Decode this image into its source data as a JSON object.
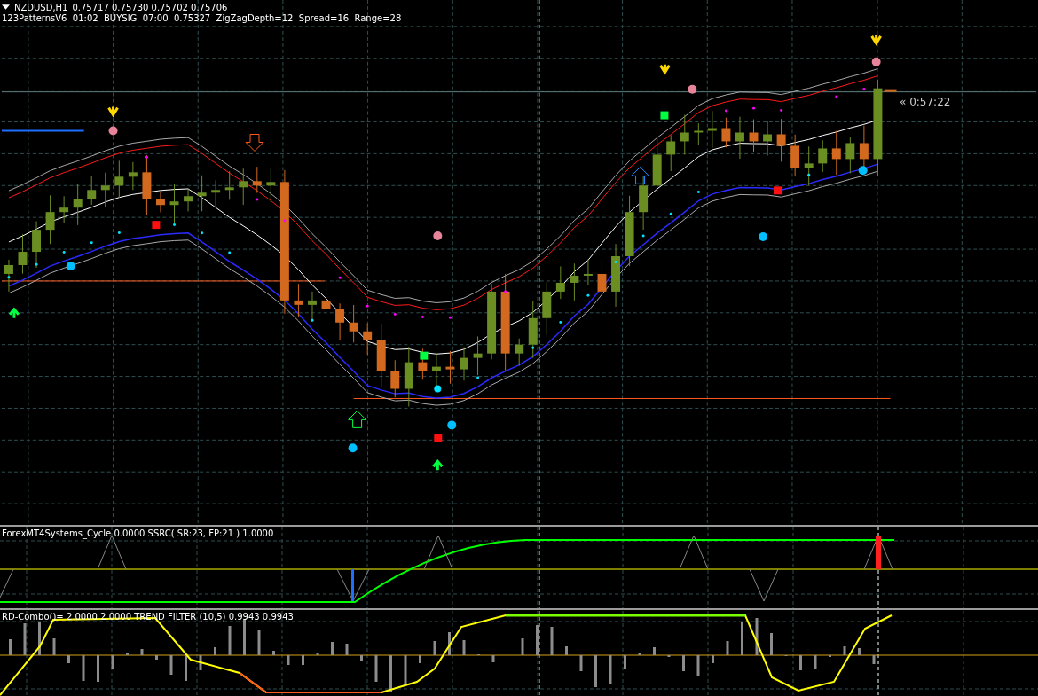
{
  "main_chart": {
    "symbol": "NZDUSD,H1",
    "quotes": "0.75717 0.75730 0.75702 0.75706",
    "indicator_info": "123PatternsV6  01:02  BUYSIG  07:00  0.75327  ZigZagDepth=12  Spread=16  Range=28",
    "timer": "« 0:57:22"
  },
  "cycle_window": {
    "label": "ForexMT4Systems_Cycle 0.0000  SSRC( SR:23, FP:21 ) 1.0000"
  },
  "combo_window": {
    "label": "RD-Combo()= 2.0000 2.0000  TREND FILTER (10,5) 0.9943 0.9943"
  }
}
